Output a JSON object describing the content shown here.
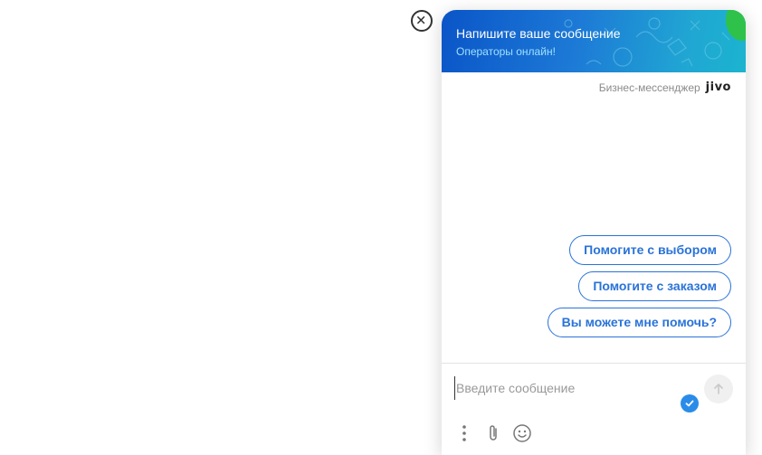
{
  "header": {
    "title": "Напишите ваше сообщение",
    "subtitle": "Операторы онлайн!"
  },
  "branding": {
    "text": "Бизнес-мессенджер",
    "logo_text": "jivo"
  },
  "quick_replies": [
    {
      "label": "Помогите с выбором"
    },
    {
      "label": "Помогите с заказом"
    },
    {
      "label": "Вы можете мне помочь?"
    }
  ],
  "input": {
    "placeholder": "Введите сообщение",
    "value": ""
  },
  "colors": {
    "accent": "#2a73d8",
    "header_gradient_start": "#0a55c8",
    "header_gradient_end": "#1bb4cf",
    "online_indicator": "#2ec24a",
    "check_badge": "#2a8ce8"
  },
  "icons": {
    "close": "close-icon",
    "send": "arrow-up-icon",
    "check": "check-icon",
    "menu": "more-vertical-icon",
    "attach": "paperclip-icon",
    "emoji": "smiley-icon"
  }
}
